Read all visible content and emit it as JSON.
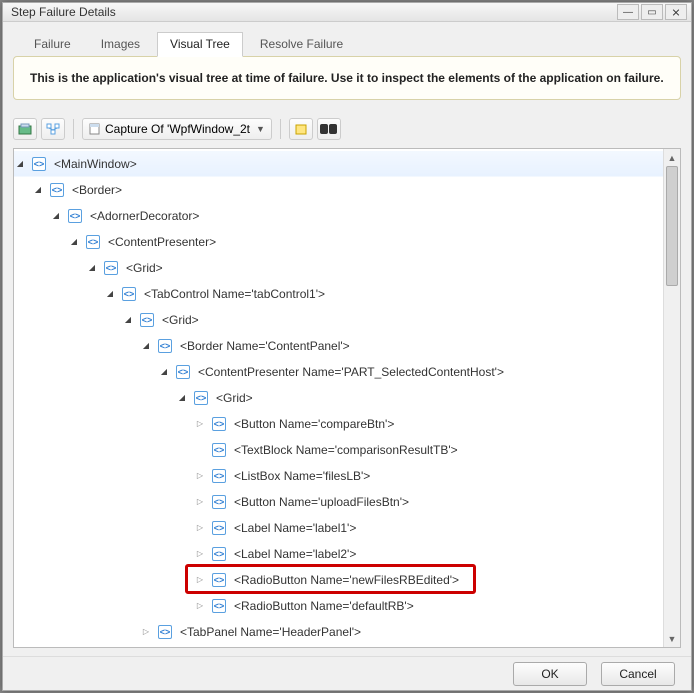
{
  "window": {
    "title": "Step Failure Details"
  },
  "tabs": [
    {
      "label": "Failure",
      "active": false
    },
    {
      "label": "Images",
      "active": false
    },
    {
      "label": "Visual Tree",
      "active": true
    },
    {
      "label": "Resolve Failure",
      "active": false
    }
  ],
  "info_text": "This is the application's visual tree at time of failure. Use it to inspect the elements of the application on failure.",
  "capture": {
    "label": "Capture Of 'WpfWindow_2t"
  },
  "tree": [
    {
      "depth": 0,
      "toggle": "open",
      "selected": true,
      "label": "<MainWindow>"
    },
    {
      "depth": 1,
      "toggle": "open",
      "label": "<Border>"
    },
    {
      "depth": 2,
      "toggle": "open",
      "label": "<AdornerDecorator>"
    },
    {
      "depth": 3,
      "toggle": "open",
      "label": "<ContentPresenter>"
    },
    {
      "depth": 4,
      "toggle": "open",
      "label": "<Grid>"
    },
    {
      "depth": 5,
      "toggle": "open",
      "label": "<TabControl Name='tabControl1'>"
    },
    {
      "depth": 6,
      "toggle": "open",
      "label": "<Grid>"
    },
    {
      "depth": 7,
      "toggle": "open",
      "label": "<Border Name='ContentPanel'>"
    },
    {
      "depth": 8,
      "toggle": "open",
      "label": "<ContentPresenter Name='PART_SelectedContentHost'>"
    },
    {
      "depth": 9,
      "toggle": "open",
      "label": "<Grid>"
    },
    {
      "depth": 10,
      "toggle": "closed",
      "label": "<Button Name='compareBtn'>"
    },
    {
      "depth": 10,
      "toggle": "none",
      "label": "<TextBlock Name='comparisonResultTB'>"
    },
    {
      "depth": 10,
      "toggle": "closed",
      "label": "<ListBox Name='filesLB'>"
    },
    {
      "depth": 10,
      "toggle": "closed",
      "label": "<Button Name='uploadFilesBtn'>"
    },
    {
      "depth": 10,
      "toggle": "closed",
      "label": "<Label Name='label1'>"
    },
    {
      "depth": 10,
      "toggle": "closed",
      "label": "<Label Name='label2'>"
    },
    {
      "depth": 10,
      "toggle": "closed",
      "label": "<RadioButton Name='newFilesRBEdited'>"
    },
    {
      "depth": 10,
      "toggle": "closed",
      "label": "<RadioButton Name='defaultRB'>"
    },
    {
      "depth": 7,
      "toggle": "closed",
      "label": "<TabPanel Name='HeaderPanel'>"
    }
  ],
  "highlight_index": 16,
  "buttons": {
    "ok": "OK",
    "cancel": "Cancel"
  }
}
